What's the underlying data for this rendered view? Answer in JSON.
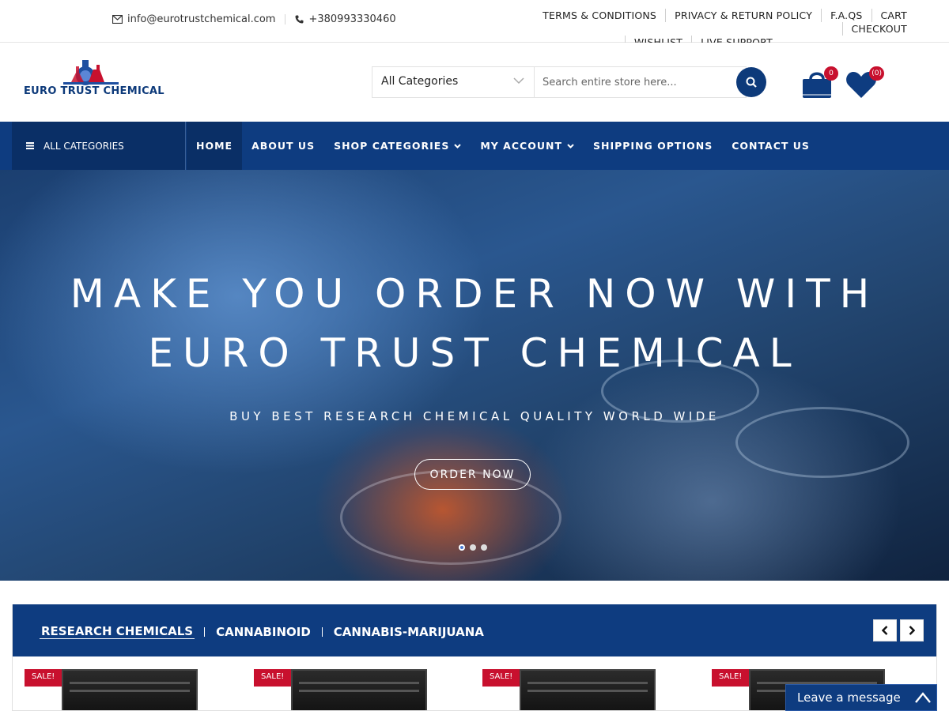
{
  "topbar": {
    "email": "info@eurotrustchemical.com",
    "phone": "+380993330460",
    "links": [
      "TERMS & CONDITIONS",
      "PRIVACY & RETURN POLICY",
      "F.A.QS",
      "CART",
      "CHECKOUT",
      "WISHLIST",
      "LIVE SUPPORT"
    ]
  },
  "header": {
    "logo_text": "EURO TRUST CHEMICAL",
    "category_select": "All Categories",
    "search_placeholder": "Search entire store here...",
    "cart_count": "0",
    "wishlist_count": "(0)"
  },
  "nav": {
    "all_categories": "ALL CATEGORIES",
    "items": [
      {
        "label": "HOME",
        "active": true
      },
      {
        "label": "ABOUT US"
      },
      {
        "label": "SHOP CATEGORIES",
        "dropdown": true
      },
      {
        "label": "MY ACCOUNT",
        "dropdown": true
      },
      {
        "label": "SHIPPING OPTIONS"
      },
      {
        "label": "CONTACT US"
      }
    ]
  },
  "hero": {
    "title_line1": "MAKE YOU ORDER NOW WITH",
    "title_line2": "EURO TRUST CHEMICAL",
    "subtitle": "BUY BEST RESEARCH CHEMICAL QUALITY WORLD WIDE",
    "cta": "ORDER NOW",
    "slides": 3,
    "active_slide": 1
  },
  "products": {
    "tabs": [
      "RESEARCH CHEMICALS",
      "CANNABINOID",
      "CANNABIS-MARIJUANA"
    ],
    "active_tab": 0,
    "sale_label": "SALE!"
  },
  "chat": {
    "label": "Leave a message"
  },
  "colors": {
    "primary": "#0e3c80",
    "primary_dark": "#0a2f66",
    "sale": "#c8102e"
  }
}
